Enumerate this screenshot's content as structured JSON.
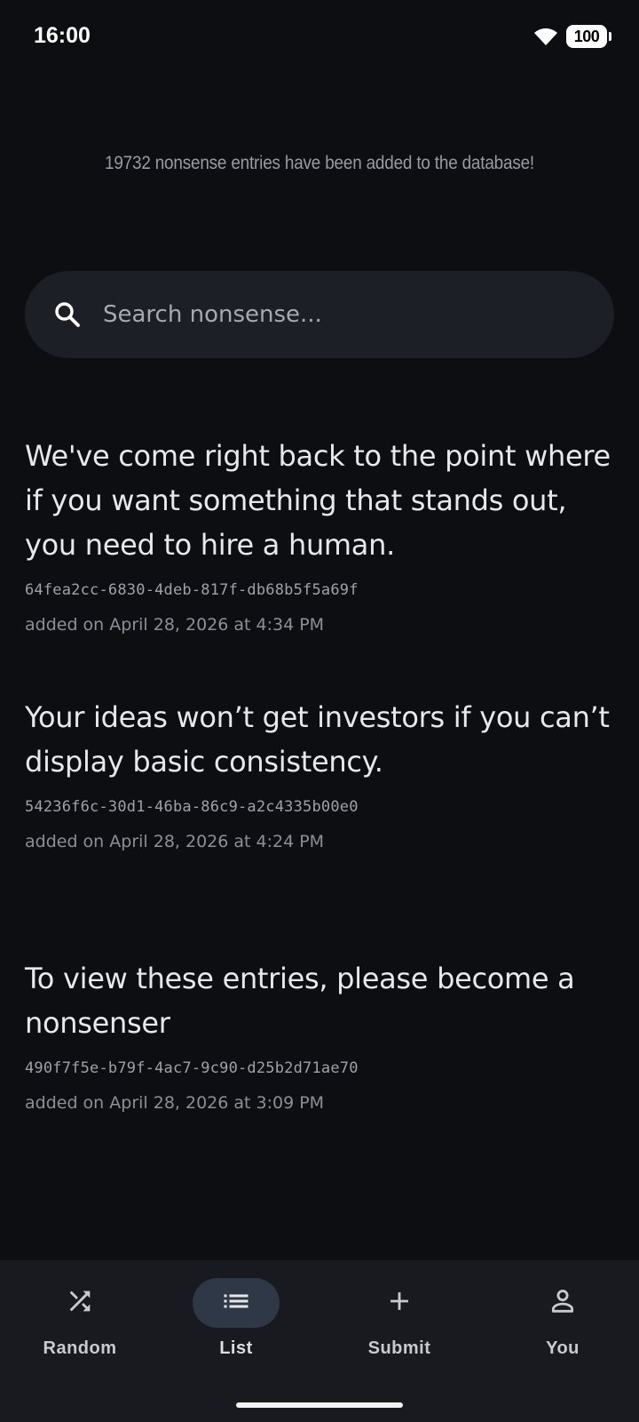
{
  "status_bar": {
    "time": "16:00",
    "battery": "100",
    "wifi_icon": "wifi-icon"
  },
  "header": {
    "entry_count_text": "19732 nonsense entries have been added to the database!"
  },
  "search": {
    "placeholder": "Search nonsense...",
    "value": "",
    "icon": "search-icon"
  },
  "entries": [
    {
      "text": "We've come right back to the point where if you want something that stands out, you need to hire a human.",
      "id": "64fea2cc-6830-4deb-817f-db68b5f5a69f",
      "date": "added on April 28, 2026 at 4:34 PM"
    },
    {
      "text": "Your ideas won’t get investors if you can’t display basic consistency.",
      "id": "54236f6c-30d1-46ba-86c9-a2c4335b00e0",
      "date": "added on April 28, 2026 at 4:24 PM"
    },
    {
      "text": "To view these entries, please become a nonsenser",
      "id": "490f7f5e-b79f-4ac7-9c90-d25b2d71ae70",
      "date": "added on April 28, 2026 at 3:09 PM"
    }
  ],
  "nav": {
    "items": [
      {
        "label": "Random",
        "icon": "shuffle-icon",
        "active": false
      },
      {
        "label": "List",
        "icon": "list-icon",
        "active": true
      },
      {
        "label": "Submit",
        "icon": "plus-icon",
        "active": false
      },
      {
        "label": "You",
        "icon": "person-icon",
        "active": false
      }
    ]
  },
  "colors": {
    "background": "#0d0e12",
    "surface": "#1d1f26",
    "nav_background": "#181a1f",
    "active_pill": "#2f3846"
  }
}
